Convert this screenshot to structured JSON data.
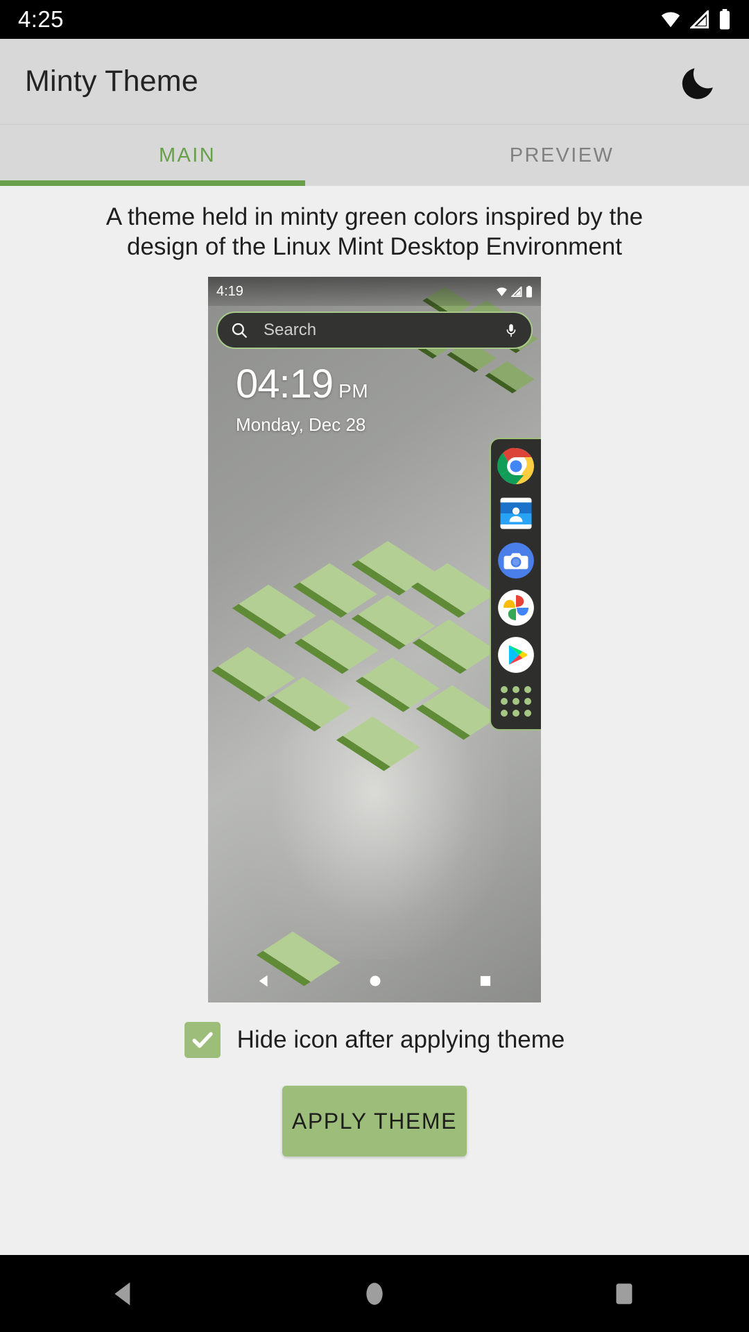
{
  "system_status_bar": {
    "time": "4:25",
    "icons": [
      "wifi-icon",
      "cellular-signal-icon",
      "battery-icon"
    ]
  },
  "app_bar": {
    "title": "Minty Theme",
    "action_icon": "moon-icon"
  },
  "tabs": {
    "items": [
      {
        "label": "MAIN",
        "active": true
      },
      {
        "label": "PREVIEW",
        "active": false
      }
    ],
    "indicator_color": "#689f4a"
  },
  "main": {
    "description": "A theme held in minty green colors inspired by the design of the Linux Mint Desktop Environment",
    "preview": {
      "status_bar": {
        "time": "4:19",
        "icons": [
          "wifi-icon",
          "cellular-signal-icon",
          "battery-icon"
        ]
      },
      "search": {
        "placeholder": "Search",
        "leading_icon": "search-icon",
        "trailing_icon": "microphone-icon",
        "border_color": "#a9c98a",
        "background_color": "#333331"
      },
      "clock": {
        "time": "04:19",
        "meridiem": "PM",
        "date": "Monday, Dec 28"
      },
      "dock": {
        "apps": [
          "chrome-icon",
          "contacts-icon",
          "camera-icon",
          "photos-icon",
          "play-store-icon"
        ],
        "drawer_icon": "app-drawer-grid-icon",
        "background_color": "#2e2e2c",
        "border_color": "#9fbf81"
      },
      "nav_bar": {
        "icons": [
          "back-icon",
          "home-icon",
          "recents-icon"
        ]
      }
    },
    "hide_icon_checkbox": {
      "label": "Hide icon after applying theme",
      "checked": true,
      "color": "#9dbd7a"
    },
    "apply_button": {
      "label": "APPLY THEME",
      "color": "#9dbd7a"
    }
  },
  "system_nav_bar": {
    "buttons": [
      "back-icon",
      "home-icon",
      "recents-icon"
    ]
  }
}
